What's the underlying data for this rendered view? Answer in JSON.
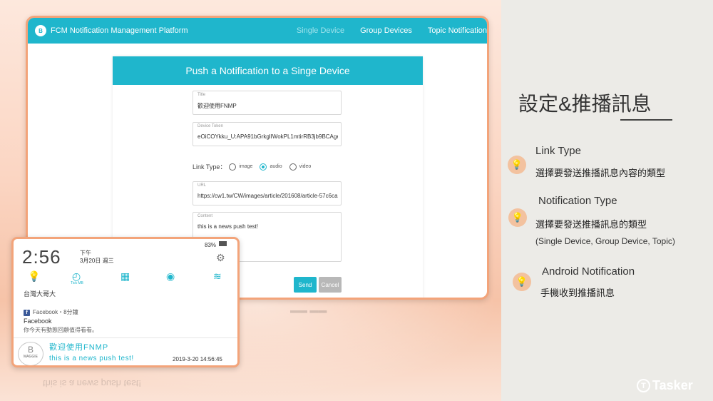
{
  "app": {
    "brand": "FCM Notification Management Platform",
    "nav": [
      "Single Device",
      "Group Devices",
      "Topic Notification"
    ]
  },
  "form": {
    "title_text": "Push a Notification to a Singe Device",
    "title_label": "Title",
    "title_value": "歡迎使用FNMP",
    "token_label": "Device Token",
    "token_value": "eOiCOYkku_U:APA91bGrkglIWokPL1mtirRB3jb9BCAge",
    "link_type_label": "Link Type：",
    "link_options": [
      "image",
      "audio",
      "video"
    ],
    "link_selected": "audio",
    "url_label": "URL",
    "url_value": "https://cw1.tw/CW/images/article/201608/article-57c6ca2",
    "content_label": "Content",
    "content_value": "this is a news push test!",
    "send": "Send",
    "cancel": "Cancel"
  },
  "phone": {
    "time": "2:56",
    "ampm": "下午",
    "date": "3月20日 週三",
    "battery": "83%",
    "carrier": "台灣大哥大",
    "qs_icons": [
      "flashlight-icon",
      "speedometer-icon",
      "calculator-icon",
      "eye-icon",
      "wifi-icon"
    ],
    "qs_sub": "Tick MB",
    "fb_source": "Facebook・8分鐘",
    "fb_title": "Facebook",
    "fb_body": "你今天有動態回顧值得看看。",
    "notif_title": "歡迎使用FNMP",
    "notif_body": "this is a news push test!",
    "notif_time": "2019-3-20 14:56:45",
    "avatar_text": "MAGGIE"
  },
  "right": {
    "heading": "設定&推播訊息",
    "items": [
      {
        "title": "Link Type",
        "desc": "選擇要發送推播訊息內容的類型"
      },
      {
        "title": "Notification Type",
        "desc": "選擇要發送推播訊息的類型",
        "note": "(Single Device, Group Device, Topic)"
      },
      {
        "title": "Android Notification",
        "desc": "手機收到推播訊息"
      }
    ],
    "logo": "Tasker"
  },
  "colors": {
    "accent": "#1fb6cc",
    "peach": "#f3a47a",
    "send": "#1fb6cc",
    "cancel": "#b8b8b8"
  }
}
